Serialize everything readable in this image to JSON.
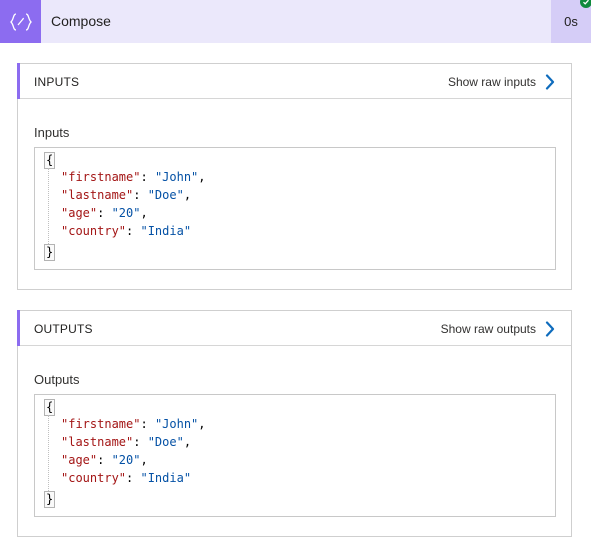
{
  "header": {
    "icon": "compose-braces-icon",
    "title": "Compose",
    "duration": "0s",
    "status": "succeeded",
    "accent_color": "#8c6cf0",
    "status_color": "#0f8a3c"
  },
  "inputs": {
    "section_title": "INPUTS",
    "raw_link_label": "Show raw inputs",
    "body_label": "Inputs",
    "open_brace": "{",
    "close_brace": "}",
    "fields": [
      {
        "key": "\"firstname\"",
        "value": "\"John\"",
        "trail": ","
      },
      {
        "key": "\"lastname\"",
        "value": "\"Doe\"",
        "trail": ","
      },
      {
        "key": "\"age\"",
        "value": "\"20\"",
        "trail": ","
      },
      {
        "key": "\"country\"",
        "value": "\"India\"",
        "trail": ""
      }
    ]
  },
  "outputs": {
    "section_title": "OUTPUTS",
    "raw_link_label": "Show raw outputs",
    "body_label": "Outputs",
    "open_brace": "{",
    "close_brace": "}",
    "fields": [
      {
        "key": "\"firstname\"",
        "value": "\"John\"",
        "trail": ","
      },
      {
        "key": "\"lastname\"",
        "value": "\"Doe\"",
        "trail": ","
      },
      {
        "key": "\"age\"",
        "value": "\"20\"",
        "trail": ","
      },
      {
        "key": "\"country\"",
        "value": "\"India\"",
        "trail": ""
      }
    ]
  }
}
